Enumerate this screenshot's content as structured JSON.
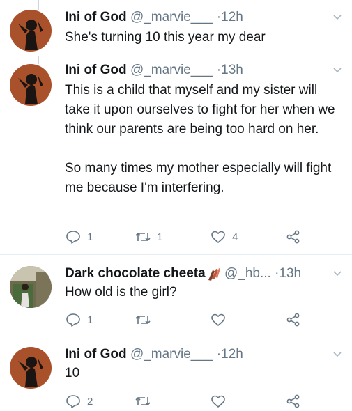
{
  "tweets": [
    {
      "name": "Ini of God",
      "handle": "@_marvie___",
      "time": "12h",
      "text": "She's turning 10 this year my dear"
    },
    {
      "name": "Ini of God",
      "handle": "@_marvie___",
      "time": "13h",
      "text": "This is a child that myself and my sister will take it upon ourselves to fight for her when we think our parents are being too hard on her.\n\nSo many times my mother especially will fight me because I'm interfering.",
      "replies": "1",
      "retweets": "1",
      "likes": "4"
    },
    {
      "name": "Dark chocolate cheeta",
      "handle": "@_hb...",
      "time": "13h",
      "text": "How old is the girl?",
      "replies": "1"
    },
    {
      "name": "Ini of God",
      "handle": "@_marvie___",
      "time": "12h",
      "text": "10",
      "replies": "2"
    }
  ],
  "separator": "·",
  "colors": {
    "text": "#14171a",
    "muted": "#657786",
    "thread": "#ccd6dd",
    "avatar_bg": "#a9512a"
  }
}
